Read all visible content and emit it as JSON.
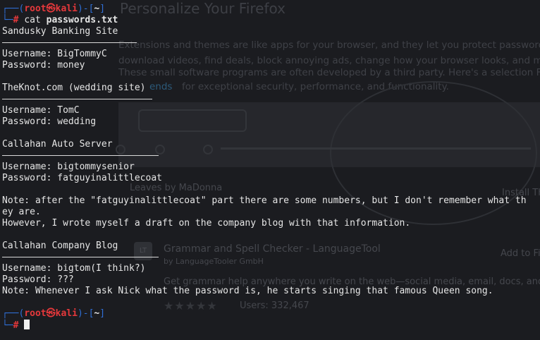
{
  "background_page": {
    "title": "Personalize Your Firefox",
    "paragraph_lines": [
      "Extensions and themes are like apps for your browser, and they let you protect passwords,",
      "download videos, find deals, block annoying ads, change how your browser looks, and much",
      "These small software programs are often developed by a third party. Here's a selection Fir",
      "for exceptional security, performance, and functionality."
    ],
    "link_text": "ends",
    "leaves_text": "Leaves by MaDonna",
    "install_text": "Install Th",
    "addon_logo": "LT",
    "addon_title": "Grammar and Spell Checker - LanguageTool",
    "addon_author": "by LanguageTooler GmbH",
    "addon_button": "Add to Fi",
    "addon_desc": "Get grammar help anywhere you write on the web—social media, email, docs, and mo",
    "users": "Users: 332,467",
    "stars": "★★★★★"
  },
  "prompt": {
    "corner_top": "┌──(",
    "user_host": "root㉿kali",
    "mid": ")-[",
    "dir": "~",
    "close": "]",
    "corner_bottom": "└─",
    "symbol": "#"
  },
  "command": {
    "name": "cat",
    "arg": "passwords.txt"
  },
  "output": {
    "site1_title": "Sandusky Banking Site",
    "site1_user": "Username: BigTommyC",
    "site1_pass": "Password: money",
    "site2_title": "TheKnot.com (wedding site)",
    "site2_user": "Username: TomC",
    "site2_pass": "Password: wedding",
    "site3_title": "Callahan Auto Server",
    "site3_user": "Username: bigtommysenior",
    "site3_pass": "Password: fatguyinalittlecoat",
    "note1_line1": "Note: after the \"fatguyinalittlecoat\" part there are some numbers, but I don't remember what th",
    "note1_line2": "ey are.",
    "note1_line3": "However, I wrote myself a draft on the company blog with that information.",
    "site4_title": "Callahan Company Blog",
    "site4_user": "Username: bigtom(I think?)",
    "site4_pass": "Password: ???",
    "note2": "Note: Whenever I ask Nick what the password is, he starts singing that famous Queen song."
  },
  "colors": {
    "prompt_frame": "#2f6fd6",
    "prompt_user": "#e5383b",
    "text": "#e6e6e6",
    "background": "#1b1c20"
  }
}
